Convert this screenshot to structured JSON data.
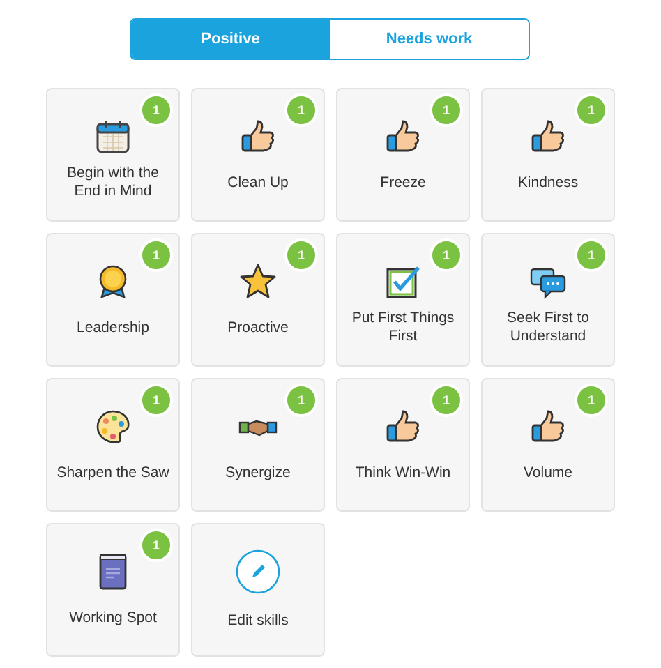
{
  "tabs": [
    {
      "label": "Positive",
      "selected": true
    },
    {
      "label": "Needs work",
      "selected": false
    }
  ],
  "skills": [
    {
      "kind": "calendar",
      "label": "Begin with the End in Mind",
      "count": "1"
    },
    {
      "kind": "thumbs",
      "label": "Clean Up",
      "count": "1"
    },
    {
      "kind": "thumbs",
      "label": "Freeze",
      "count": "1"
    },
    {
      "kind": "thumbs",
      "label": "Kindness",
      "count": "1"
    },
    {
      "kind": "medal",
      "label": "Leadership",
      "count": "1"
    },
    {
      "kind": "star",
      "label": "Proactive",
      "count": "1"
    },
    {
      "kind": "checkbox",
      "label": "Put First Things First",
      "count": "1"
    },
    {
      "kind": "chat",
      "label": "Seek First to Understand",
      "count": "1"
    },
    {
      "kind": "palette",
      "label": "Sharpen the Saw",
      "count": "1"
    },
    {
      "kind": "handshake",
      "label": "Synergize",
      "count": "1"
    },
    {
      "kind": "thumbs",
      "label": "Think Win-Win",
      "count": "1"
    },
    {
      "kind": "thumbs",
      "label": "Volume",
      "count": "1"
    },
    {
      "kind": "book",
      "label": "Working Spot",
      "count": "1"
    },
    {
      "kind": "edit",
      "label": "Edit skills"
    }
  ]
}
